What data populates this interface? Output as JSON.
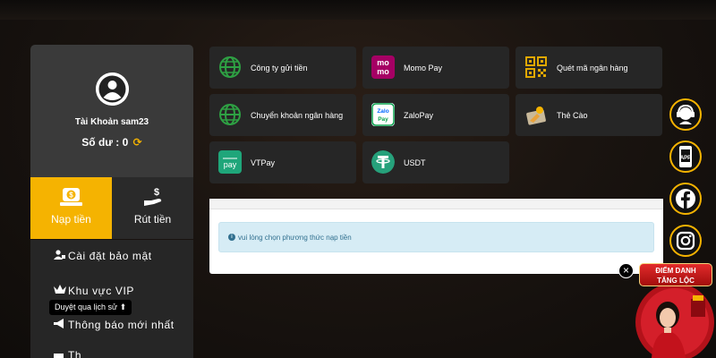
{
  "profile": {
    "account_label": "Tài Khoản sam23",
    "balance_label": "Số dư : 0"
  },
  "tabs": [
    {
      "label": "Nạp tiền",
      "icon": "deposit-icon",
      "active": true
    },
    {
      "label": "Rút tiền",
      "icon": "withdraw-icon",
      "active": false
    }
  ],
  "menu": [
    {
      "label": "Cài đặt bảo mật",
      "icon": "user-lock-icon"
    },
    {
      "label": "Khu vực VIP",
      "icon": "crown-icon"
    },
    {
      "label": "Thông báo mới nhất",
      "icon": "megaphone-icon"
    },
    {
      "label": "Th",
      "icon": "message-icon"
    }
  ],
  "tooltip": "Duyệt qua lịch sử",
  "payment_methods": [
    {
      "label": "Công ty gửi tiền",
      "icon": "globe-icon"
    },
    {
      "label": "Momo Pay",
      "icon": "momo-icon",
      "logo_text": "mo mo"
    },
    {
      "label": "Quét mã ngân hàng",
      "icon": "qr-code-icon"
    },
    {
      "label": "Chuyển khoản ngân hàng",
      "icon": "globe-icon"
    },
    {
      "label": "ZaloPay",
      "icon": "zalopay-icon",
      "logo_text": "Zalo Pay"
    },
    {
      "label": "Thẻ Cào",
      "icon": "scratch-card-icon"
    },
    {
      "label": "VTPay",
      "icon": "vtpay-icon",
      "logo_text": "pay"
    },
    {
      "label": "USDT",
      "icon": "tether-icon"
    }
  ],
  "message": "vui lòng chọn phương thức nạp tiền",
  "floating": [
    {
      "icon": "support-agent-icon"
    },
    {
      "icon": "app-download-icon",
      "text": "APP"
    },
    {
      "icon": "facebook-icon"
    },
    {
      "icon": "instagram-icon"
    }
  ],
  "promo": {
    "line1": "ĐIỂM DANH",
    "line2": "TĂNG LỘC"
  },
  "colors": {
    "accent": "#f5b301",
    "panel": "#262626",
    "profile_bg": "#3a3a3a",
    "info_text": "#31708f",
    "info_bg": "#d6ecf5"
  }
}
